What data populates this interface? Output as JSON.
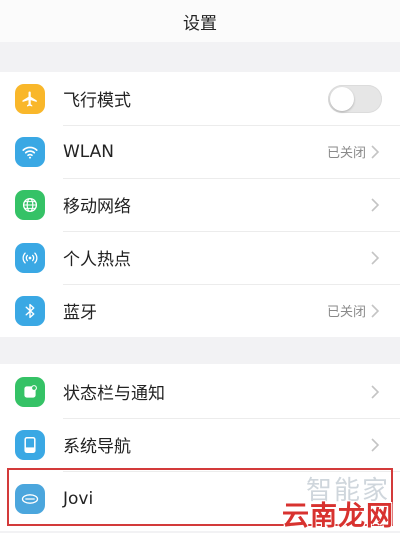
{
  "header": {
    "title": "设置"
  },
  "group1": [
    {
      "key": "airplane",
      "label": "飞行模式",
      "icon": "airplane-icon",
      "icon_color": "#f9b72a",
      "control": "toggle",
      "toggle_on": false
    },
    {
      "key": "wlan",
      "label": "WLAN",
      "icon": "wifi-icon",
      "icon_color": "#3aa8e4",
      "status": "已关闭"
    },
    {
      "key": "mobile",
      "label": "移动网络",
      "icon": "globe-icon",
      "icon_color": "#35c266"
    },
    {
      "key": "hotspot",
      "label": "个人热点",
      "icon": "hotspot-icon",
      "icon_color": "#3aa8e4"
    },
    {
      "key": "bluetooth",
      "label": "蓝牙",
      "icon": "bluetooth-icon",
      "icon_color": "#3aa8e4",
      "status": "已关闭"
    }
  ],
  "group2": [
    {
      "key": "statusbar",
      "label": "状态栏与通知",
      "icon": "notification-icon",
      "icon_color": "#35c266"
    },
    {
      "key": "navigation",
      "label": "系统导航",
      "icon": "navigation-icon",
      "icon_color": "#3aa8e4"
    },
    {
      "key": "jovi",
      "label": "Jovi",
      "icon": "jovi-icon",
      "icon_color": "#4ba6dd"
    }
  ],
  "watermark": {
    "top": "智能家",
    "bottom": "云南龙网"
  }
}
